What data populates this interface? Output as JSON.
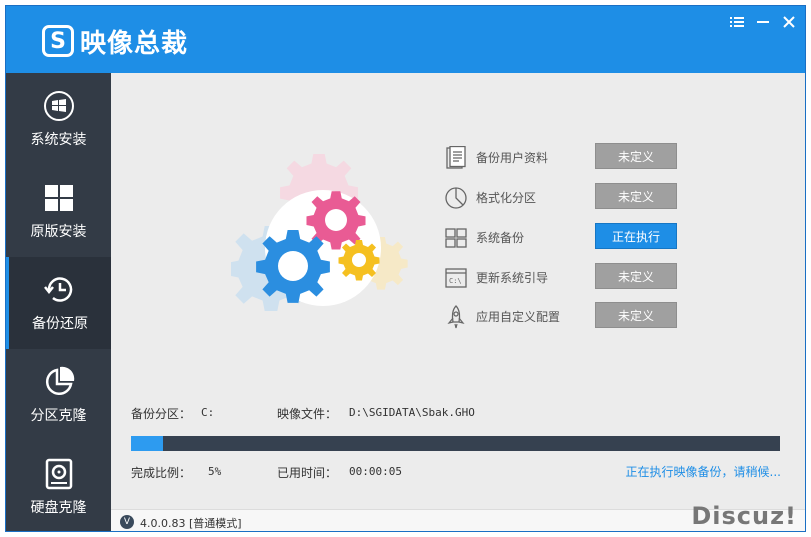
{
  "app": {
    "logo_letter": "S",
    "title": "映像总裁"
  },
  "window_controls": {
    "menu_icon": "menu-icon",
    "minimize_icon": "minimize-icon",
    "close_icon": "close-icon"
  },
  "sidebar": {
    "items": [
      {
        "label": "系统安装",
        "icon": "windows-logo-icon",
        "active": false
      },
      {
        "label": "原版安装",
        "icon": "windows-tiles-icon",
        "active": false
      },
      {
        "label": "备份还原",
        "icon": "clock-restore-icon",
        "active": true
      },
      {
        "label": "分区克隆",
        "icon": "pie-chart-icon",
        "active": false
      },
      {
        "label": "硬盘克隆",
        "icon": "hard-disk-icon",
        "active": false
      }
    ]
  },
  "tasks": [
    {
      "label": "备份用户资料",
      "status": "未定义",
      "icon": "document-icon"
    },
    {
      "label": "格式化分区",
      "status": "未定义",
      "icon": "pie-icon"
    },
    {
      "label": "系统备份",
      "status": "正在执行",
      "icon": "windows-icon"
    },
    {
      "label": "更新系统引导",
      "status": "未定义",
      "icon": "console-icon"
    },
    {
      "label": "应用自定义配置",
      "status": "未定义",
      "icon": "rocket-icon"
    }
  ],
  "backup": {
    "partition_label": "备份分区：",
    "partition_value": "C:",
    "file_label": "映像文件：",
    "file_value": "D:\\SGIDATA\\Sbak.GHO",
    "ratio_label": "完成比例：",
    "ratio_value": "5%",
    "elapsed_label": "已用时间：",
    "elapsed_value": "00:00:05",
    "progress": 0.05,
    "status_text": "正在执行映像备份，请稍候..."
  },
  "statusbar": {
    "badge": "V",
    "version": "4.0.0.83 [普通模式]",
    "watermark": "Discuz!"
  },
  "colors": {
    "accent": "#1e8ee6",
    "sidebar": "#333b46",
    "progress_track": "#364150",
    "button_idle": "#a0a0a0"
  }
}
